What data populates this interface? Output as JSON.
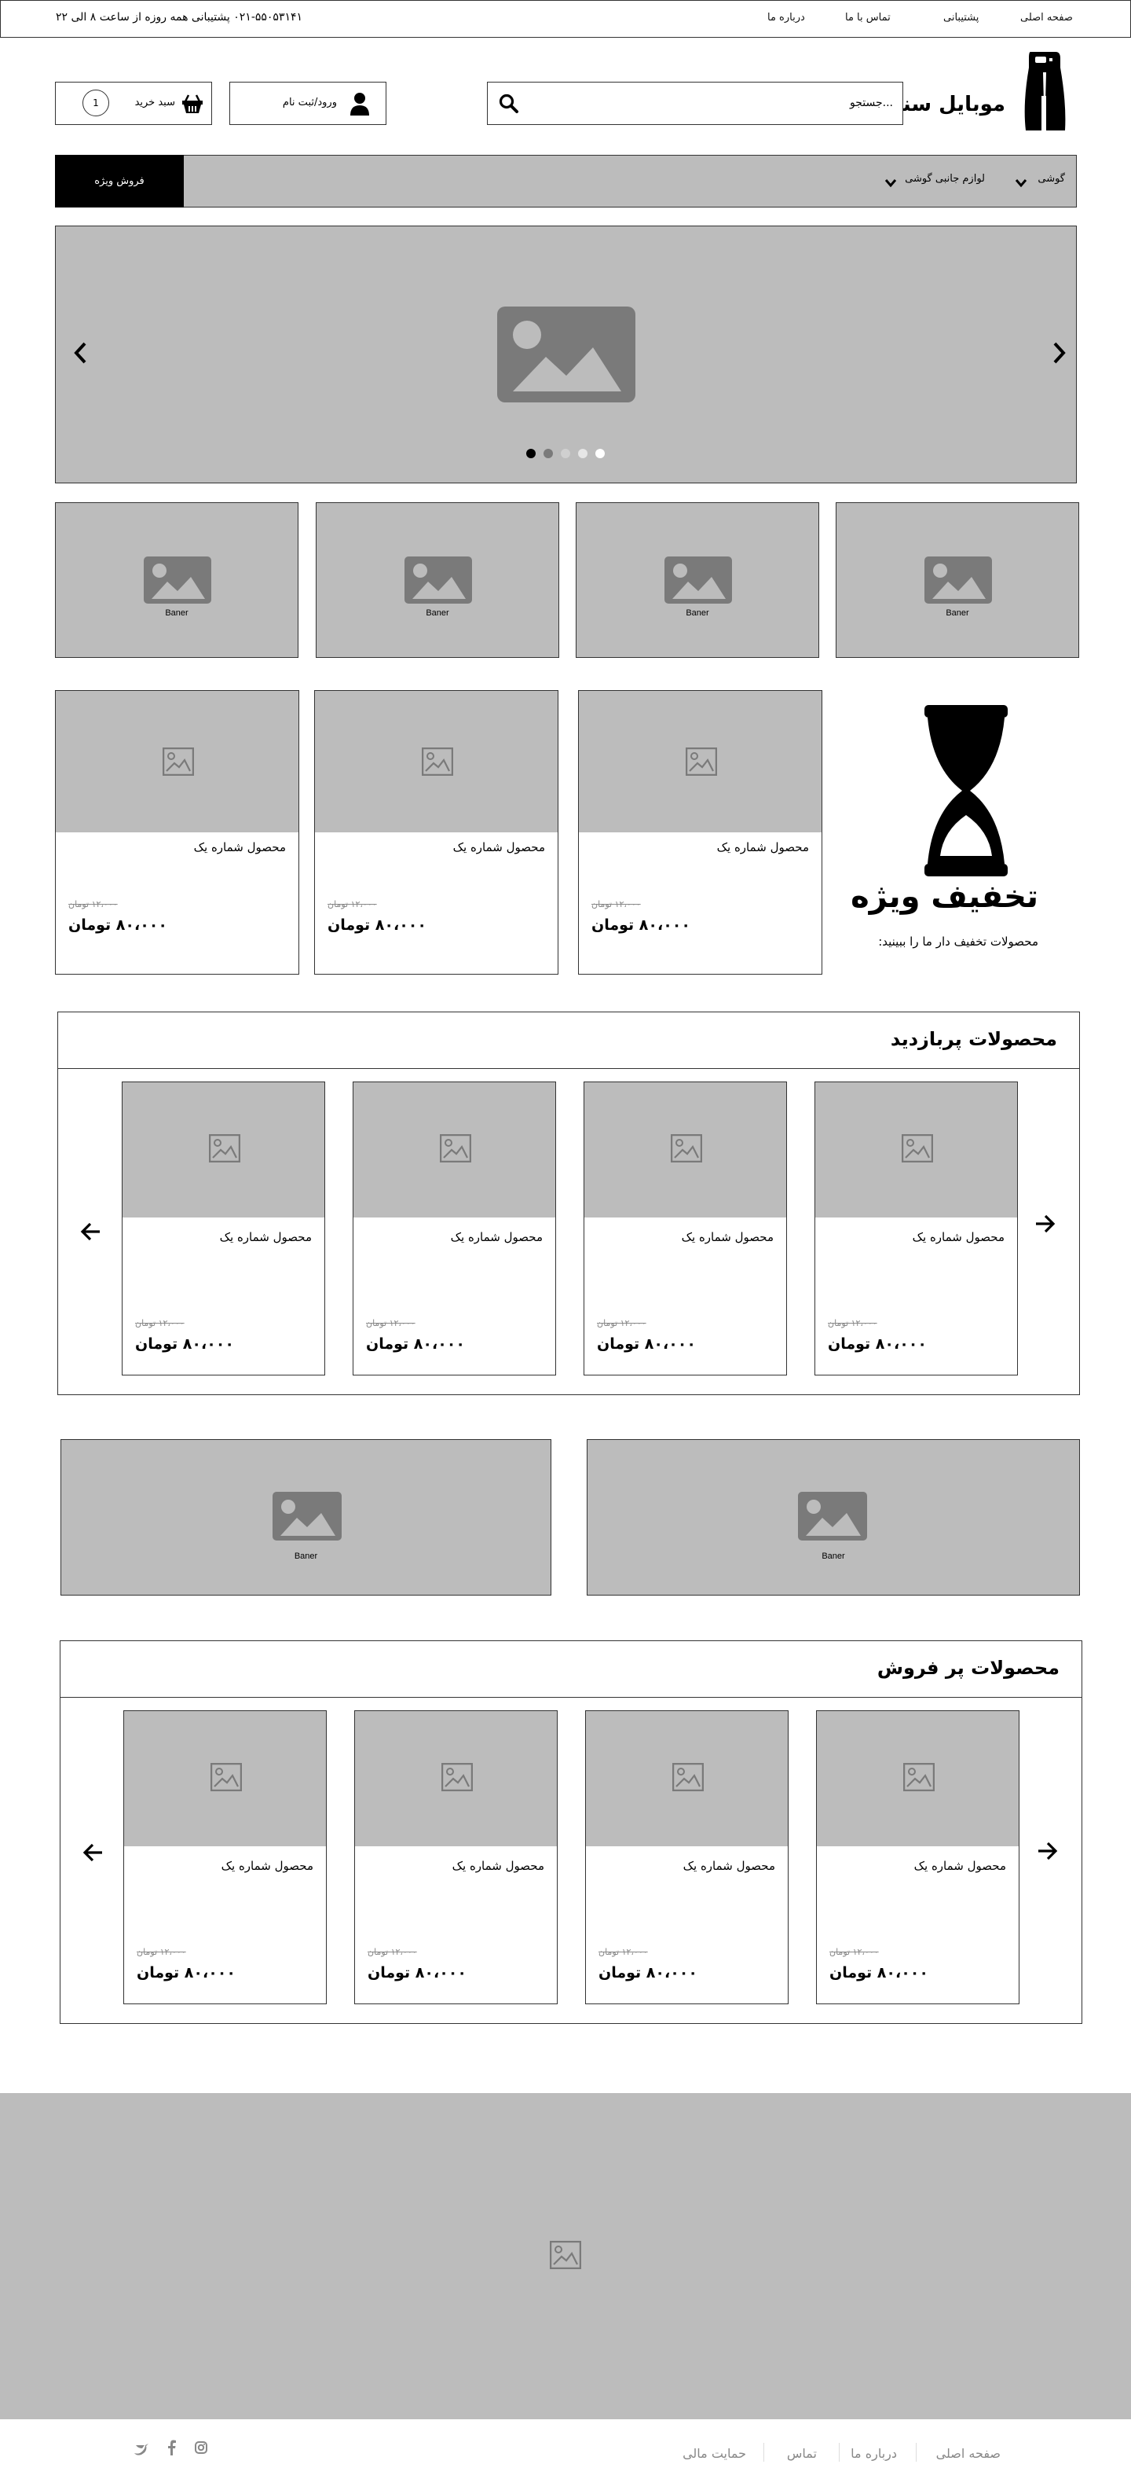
{
  "topbar": {
    "nav": [
      "صفحه اصلی",
      "پشتیبانی",
      "تماس با ما",
      "درباره ما"
    ],
    "phone": "۰۲۱-۵۵۰۵۳۱۴۱  پشتیبانی همه روزه از ساعت ۸ الی ۲۲"
  },
  "header": {
    "logo": "موبایل سنتر",
    "search_placeholder": "جستجو...",
    "login_label": "ورود/ثبت نام",
    "cart_label": "سبد خرید",
    "cart_count": "1"
  },
  "menu": {
    "items": [
      "گوشی",
      "لوازم جانبی گوشی"
    ],
    "special": "فروش ویژه"
  },
  "slider": {
    "dots": 5,
    "active_dot": 0
  },
  "banners": {
    "label": "Baner"
  },
  "discount": {
    "title": "تخفیف ویژه",
    "subtitle": "محصولات تخفیف دار ما را ببینید:"
  },
  "product": {
    "name": "محصول شماره یک",
    "old_price": "۱۲،۰۰۰ تومان",
    "price": "۸۰،۰۰۰ تومان"
  },
  "sections": {
    "most_visited": "محصولات پربازدید",
    "best_selling": "محصولات پر فروش"
  },
  "footer": {
    "links": [
      "صفحه اصلی",
      "درباره ما",
      "تماس",
      "حمایت مالی"
    ]
  },
  "colors": {
    "placeholder_gray": "#bcbcbc",
    "dark": "#000000",
    "icon_gray": "#7a7a7a"
  }
}
